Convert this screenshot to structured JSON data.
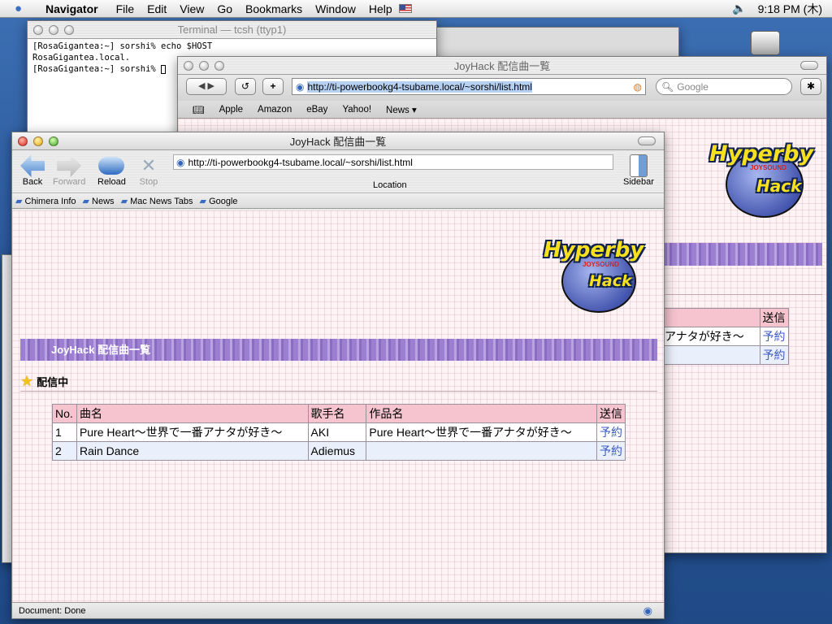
{
  "menubar": {
    "app": "Navigator",
    "items": [
      "File",
      "Edit",
      "View",
      "Go",
      "Bookmarks",
      "Window",
      "Help"
    ],
    "time": "9:18 PM (木)"
  },
  "terminal": {
    "title": "Terminal — tcsh (ttyp1)",
    "lines": [
      "[RosaGigantea:~] sorshi% echo $HOST",
      "RosaGigantea.local.",
      "[RosaGigantea:~] sorshi% "
    ]
  },
  "safari": {
    "title": "JoyHack 配信曲一覧",
    "url": "http://ti-powerbookg4-tsubame.local/~sorshi/list.html",
    "search_placeholder": "Google",
    "bookmarks": [
      "Apple",
      "Amazon",
      "eBay",
      "Yahoo!",
      "News ▾"
    ],
    "partial": {
      "cell1": "アナタが好き〜",
      "head": "送信",
      "link": "予約"
    }
  },
  "chimera": {
    "title": "JoyHack 配信曲一覧",
    "toolbar": {
      "back": "Back",
      "forward": "Forward",
      "reload": "Reload",
      "stop": "Stop",
      "location": "Location",
      "sidebar": "Sidebar"
    },
    "url": "http://ti-powerbookg4-tsubame.local/~sorshi/list.html",
    "bookmarks": [
      "Chimera Info",
      "News",
      "Mac News Tabs",
      "Google"
    ],
    "status": "Document: Done"
  },
  "page": {
    "banner": "JoyHack 配信曲一覧",
    "section": "配信中",
    "logo": {
      "l1": "Hyperby",
      "l2": "JOYSOUND",
      "l3": "Hack"
    },
    "table": {
      "headers": [
        "No.",
        "曲名",
        "歌手名",
        "作品名",
        "送信"
      ],
      "rows": [
        {
          "no": "1",
          "song": "Pure Heart〜世界で一番アナタが好き〜",
          "artist": "AKI",
          "work": "Pure Heart〜世界で一番アナタが好き〜",
          "action": "予約"
        },
        {
          "no": "2",
          "song": "Rain Dance",
          "artist": "Adiemus",
          "work": "",
          "action": "予約"
        }
      ]
    }
  }
}
